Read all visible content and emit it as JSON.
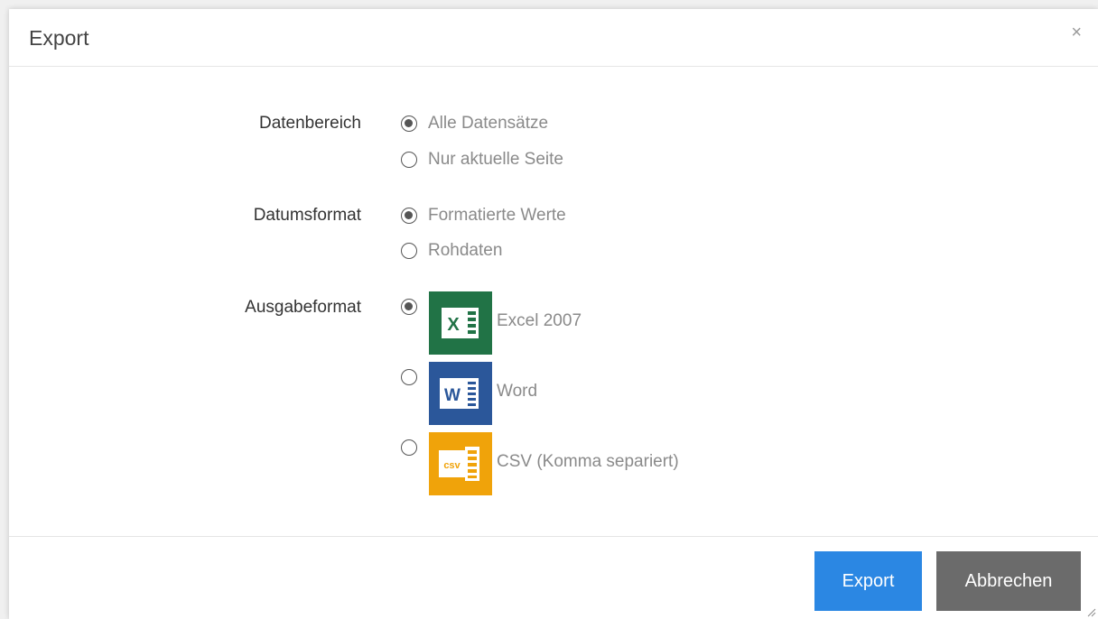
{
  "dialog": {
    "title": "Export",
    "close_label": "×"
  },
  "form": {
    "datenbereich": {
      "label": "Datenbereich",
      "options": [
        {
          "label": "Alle Datensätze",
          "checked": true
        },
        {
          "label": "Nur aktuelle Seite",
          "checked": false
        }
      ]
    },
    "datumsformat": {
      "label": "Datumsformat",
      "options": [
        {
          "label": "Formatierte Werte",
          "checked": true
        },
        {
          "label": "Rohdaten",
          "checked": false
        }
      ]
    },
    "ausgabeformat": {
      "label": "Ausgabeformat",
      "options": [
        {
          "label": "Excel 2007",
          "icon": "excel-icon",
          "icon_color": "#217346",
          "checked": true
        },
        {
          "label": "Word",
          "icon": "word-icon",
          "icon_color": "#2b579a",
          "checked": false
        },
        {
          "label": "CSV (Komma separiert)",
          "icon": "csv-icon",
          "icon_color": "#f0a30a",
          "checked": false
        }
      ]
    }
  },
  "footer": {
    "export_label": "Export",
    "cancel_label": "Abbrechen"
  },
  "colors": {
    "primary": "#2b87e3",
    "secondary": "#6b6b6b"
  }
}
